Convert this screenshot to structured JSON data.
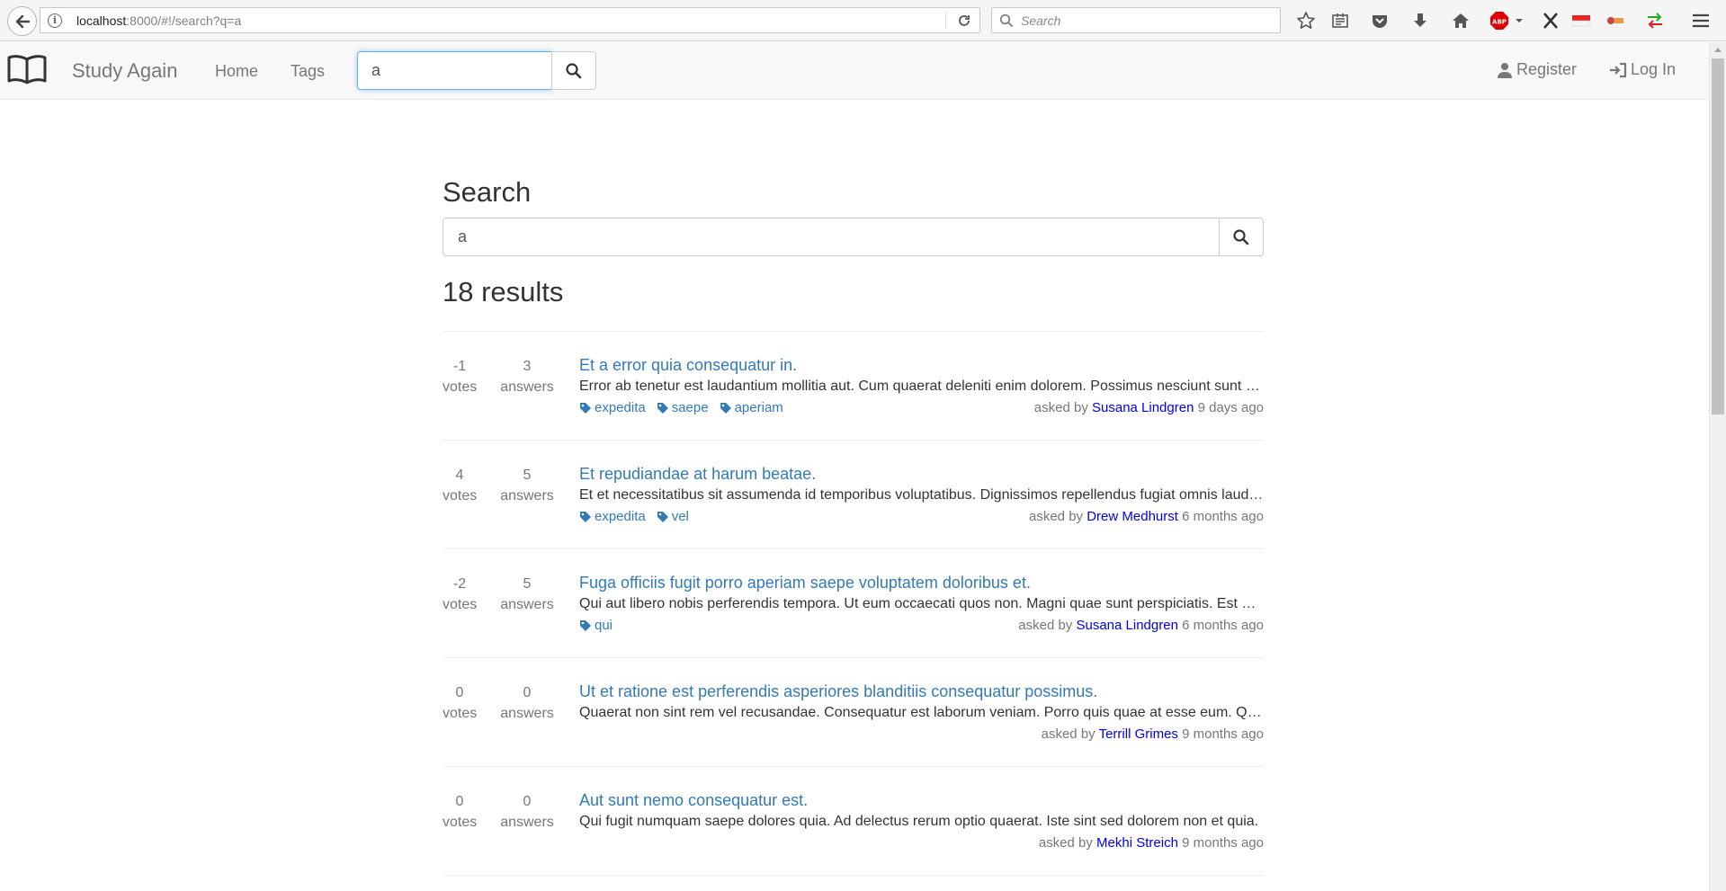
{
  "browser": {
    "url_host": "localhost",
    "url_rest": ":8000/#!/search?q=a",
    "search_placeholder": "Search",
    "abp_label": "ABP"
  },
  "nav": {
    "brand": "Study Again",
    "home": "Home",
    "tags": "Tags",
    "search_value": "a",
    "register": "Register",
    "login": "Log In"
  },
  "main": {
    "title": "Search",
    "search_value": "a",
    "results_count": "18 results"
  },
  "labels": {
    "votes": "votes",
    "answers": "answers",
    "asked_by": "asked by"
  },
  "results": [
    {
      "votes": "-1",
      "answers": "3",
      "title": "Et a error quia consequatur in.",
      "excerpt": "Error ab tenetur est laudantium mollitia aut. Cum quaerat deleniti enim dolorem. Possimus nesciunt sunt quia.",
      "tags": [
        "expedita",
        "saepe",
        "aperiam"
      ],
      "author": "Susana Lindgren",
      "time": "9 days ago"
    },
    {
      "votes": "4",
      "answers": "5",
      "title": "Et repudiandae at harum beatae.",
      "excerpt": "Et et necessitatibus sit assumenda id temporibus voluptatibus. Dignissimos repellendus fugiat omnis laudantium.",
      "tags": [
        "expedita",
        "vel"
      ],
      "author": "Drew Medhurst",
      "time": "6 months ago"
    },
    {
      "votes": "-2",
      "answers": "5",
      "title": "Fuga officiis fugit porro aperiam saepe voluptatem doloribus et.",
      "excerpt": "Qui aut libero nobis perferendis tempora. Ut eum occaecati quos non. Magni quae sunt perspiciatis. Est quia.",
      "tags": [
        "qui"
      ],
      "author": "Susana Lindgren",
      "time": "6 months ago"
    },
    {
      "votes": "0",
      "answers": "0",
      "title": "Ut et ratione est perferendis asperiores blanditiis consequatur possimus.",
      "excerpt": "Quaerat non sint rem vel recusandae. Consequatur est laborum veniam. Porro quis quae at esse eum. Quia ut.",
      "tags": [],
      "author": "Terrill Grimes",
      "time": "9 months ago"
    },
    {
      "votes": "0",
      "answers": "0",
      "title": "Aut sunt nemo consequatur est.",
      "excerpt": "Qui fugit numquam saepe dolores quia. Ad delectus rerum optio quaerat. Iste sint sed dolorem non et quia.",
      "tags": [],
      "author": "Mekhi Streich",
      "time": "9 months ago"
    }
  ],
  "colors": {
    "link": "#337ab7",
    "author": "#0000ee",
    "muted": "#777777"
  }
}
